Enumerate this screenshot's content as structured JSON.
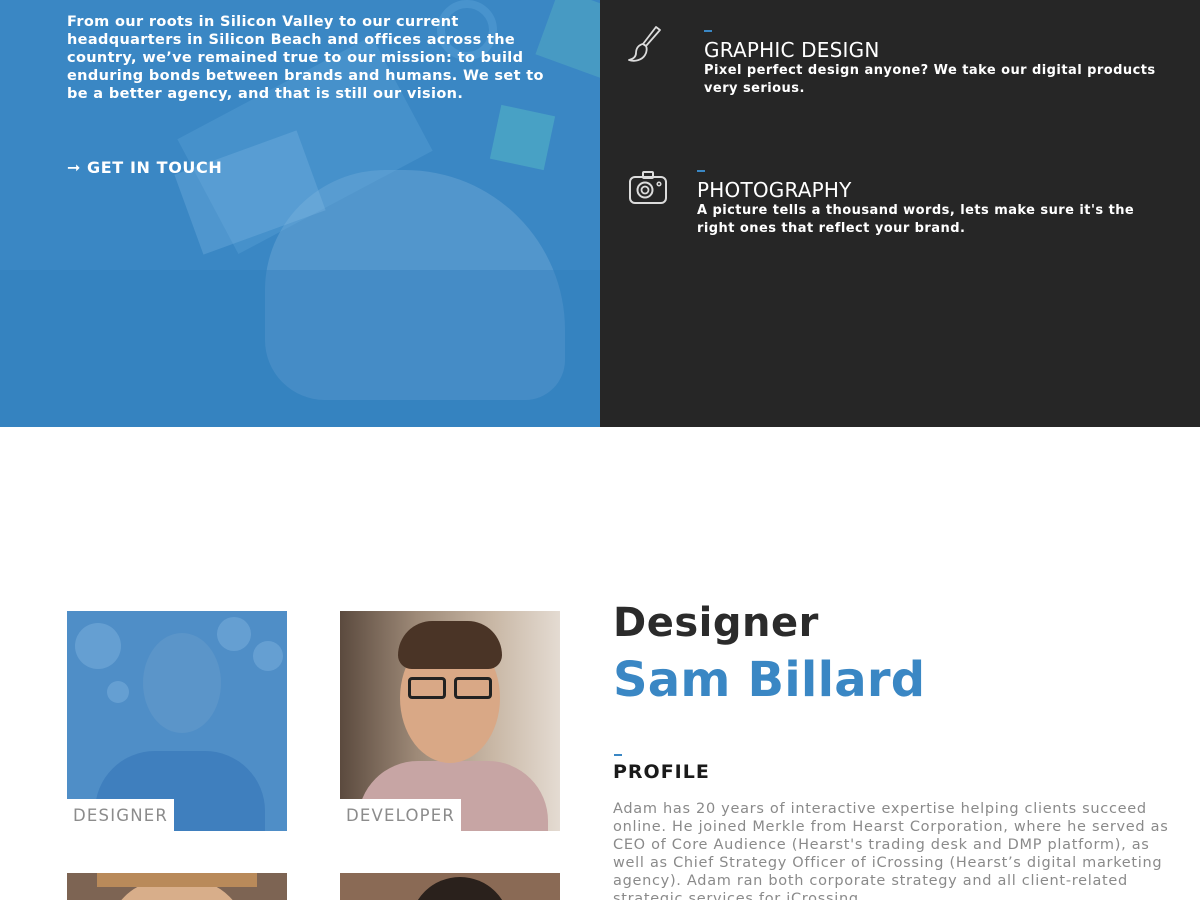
{
  "hero": {
    "intro": "From our roots in Silicon Valley to our current headquarters in Silicon Beach and offices across the country, we’ve remained true to our mission: to build enduring bonds between brands and humans. We set to be a better agency, and that is still our vision.",
    "cta_arrow": "➞",
    "cta_label": "GET IN TOUCH"
  },
  "services": [
    {
      "icon": "paintbrush-icon",
      "title": "GRAPHIC DESIGN",
      "description": "Pixel perfect design anyone? We take our digital products very serious."
    },
    {
      "icon": "camera-icon",
      "title": "PHOTOGRAPHY",
      "description": "A picture tells a thousand words, lets make sure it's the right ones that reflect your brand."
    }
  ],
  "team": [
    {
      "role": "DESIGNER",
      "selected": true
    },
    {
      "role": "DEVELOPER",
      "selected": false
    },
    {
      "role": "",
      "selected": false
    },
    {
      "role": "",
      "selected": false
    }
  ],
  "profile": {
    "role": "Designer",
    "name": "Sam Billard",
    "heading": "PROFILE",
    "bio": "Adam has 20 years of interactive expertise helping clients succeed online. He joined Merkle from Hearst Corporation, where he served as CEO of Core Audience (Hearst's trading desk and DMP platform), as well as Chief Strategy Officer of iCrossing (Hearst’s digital marketing agency). Adam ran both corporate strategy and all client-related strategic services for iCrossing."
  },
  "colors": {
    "accent": "#3a87c4",
    "dark_panel": "#262626",
    "muted_text": "#8a8a8a"
  }
}
